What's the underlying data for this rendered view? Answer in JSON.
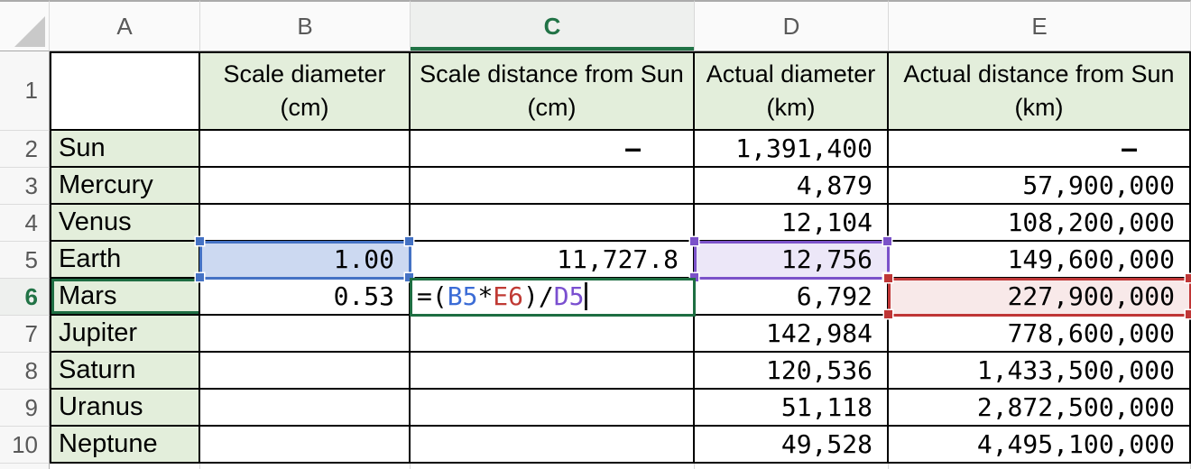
{
  "grid": {
    "column_headers": [
      "A",
      "B",
      "C",
      "D",
      "E"
    ],
    "row_headers": [
      "1",
      "2",
      "3",
      "4",
      "5",
      "6",
      "7",
      "8",
      "9",
      "10"
    ],
    "active_column": "C",
    "active_row": "6"
  },
  "table": {
    "column_titles": {
      "b_line1": "Scale diameter",
      "b_line2": "(cm)",
      "c_line1": "Scale distance from Sun",
      "c_line2": "(cm)",
      "d_line1": "Actual diameter",
      "d_line2": "(km)",
      "e_line1": "Actual distance from Sun",
      "e_line2": "(km)"
    },
    "rows": [
      {
        "name": "Sun",
        "scale_diameter": "",
        "scale_distance": "–",
        "actual_diameter": "1,391,400",
        "actual_distance": "–"
      },
      {
        "name": "Mercury",
        "scale_diameter": "",
        "scale_distance": "",
        "actual_diameter": "4,879",
        "actual_distance": "57,900,000"
      },
      {
        "name": "Venus",
        "scale_diameter": "",
        "scale_distance": "",
        "actual_diameter": "12,104",
        "actual_distance": "108,200,000"
      },
      {
        "name": "Earth",
        "scale_diameter": "1.00",
        "scale_distance": "11,727.8",
        "actual_diameter": "12,756",
        "actual_distance": "149,600,000"
      },
      {
        "name": "Mars",
        "scale_diameter": "0.53",
        "scale_distance": "",
        "actual_diameter": "6,792",
        "actual_distance": "227,900,000"
      },
      {
        "name": "Jupiter",
        "scale_diameter": "",
        "scale_distance": "",
        "actual_diameter": "142,984",
        "actual_distance": "778,600,000"
      },
      {
        "name": "Saturn",
        "scale_diameter": "",
        "scale_distance": "",
        "actual_diameter": "120,536",
        "actual_distance": "1,433,500,000"
      },
      {
        "name": "Uranus",
        "scale_diameter": "",
        "scale_distance": "",
        "actual_diameter": "51,118",
        "actual_distance": "2,872,500,000"
      },
      {
        "name": "Neptune",
        "scale_diameter": "",
        "scale_distance": "",
        "actual_diameter": "49,528",
        "actual_distance": "4,495,100,000"
      }
    ]
  },
  "formula_edit": {
    "cell": "C6",
    "full_formula": "=(B5*E6)/D5",
    "segments": {
      "open": "=(",
      "ref_b5": "B5",
      "times": "*",
      "ref_e6": "E6",
      "close_div": ")/",
      "ref_d5": "D5"
    }
  },
  "colors": {
    "accent_green": "#217346",
    "edit_border_green": "#1e6e42",
    "header_fill_green": "#e3eedb",
    "selection_blue": "#4472c4",
    "selection_blue_fill": "#ccd9f1",
    "selection_purple": "#7b52c9",
    "selection_purple_fill": "#ece7f8",
    "selection_red": "#bf3636",
    "selection_red_fill": "#f8e9e9",
    "formula_ref_blue": "#3b6cd6",
    "formula_ref_red": "#c03a34",
    "formula_ref_purple": "#7a4fd0"
  }
}
